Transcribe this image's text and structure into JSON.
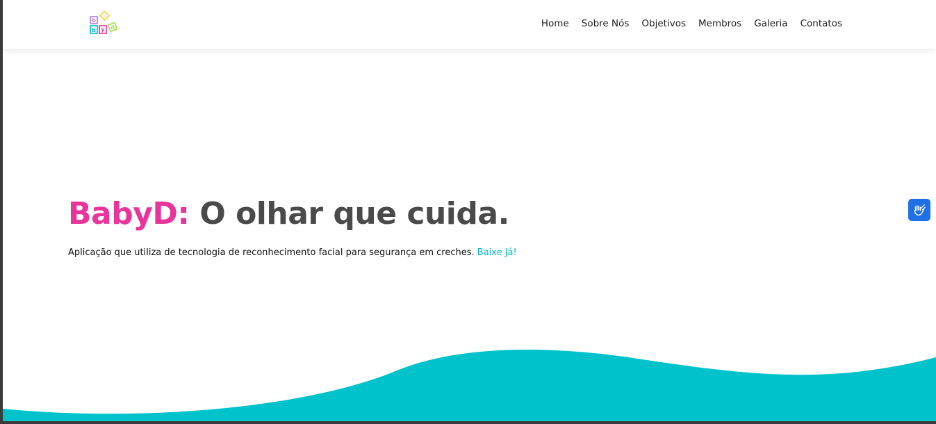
{
  "header": {
    "logo_alt": "BabyD logo",
    "nav": [
      {
        "label": "Home"
      },
      {
        "label": "Sobre Nós"
      },
      {
        "label": "Objetivos"
      },
      {
        "label": "Membros"
      },
      {
        "label": "Galeria"
      },
      {
        "label": "Contatos"
      }
    ]
  },
  "hero": {
    "brand": "BabyD:",
    "tagline": " O olhar que cuida.",
    "description": "Aplicação que utiliza de tecnologia de reconhecimento facial para segurança em creches.",
    "cta": "Baixe Já!"
  },
  "accessibility": {
    "icon": "sign-language-icon"
  },
  "colors": {
    "brand_pink": "#e8349b",
    "accent_teal": "#00bcc9",
    "title_gray": "#4a4a4a",
    "a11y_blue": "#1f6fe6"
  }
}
